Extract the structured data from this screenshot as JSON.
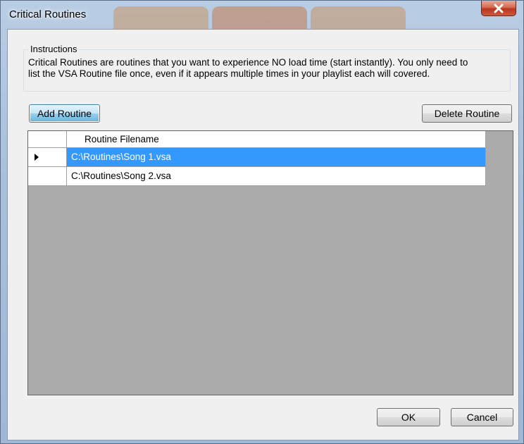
{
  "window": {
    "title": "Critical Routines"
  },
  "instructions": {
    "group_title": "Instructions",
    "line1": "Critical Routines are routines that you want to experience NO load time (start instantly). You only need to",
    "line2": "list the VSA Routine file once, even if it appears multiple times in your playlist each will covered."
  },
  "toolbar": {
    "add_label": "Add Routine",
    "delete_label": "Delete Routine"
  },
  "grid": {
    "columns": [
      "Routine Filename"
    ],
    "rows": [
      {
        "filename": "C:\\Routines\\Song 1.vsa",
        "selected": true
      },
      {
        "filename": "C:\\Routines\\Song 2.vsa",
        "selected": false
      }
    ]
  },
  "footer": {
    "ok_label": "OK",
    "cancel_label": "Cancel"
  },
  "icons": {
    "close": "close-icon",
    "current_row": "triangle-right-icon"
  },
  "colors": {
    "selection": "#3399ff",
    "grid_background": "#ababab",
    "close_button": "#c4432b"
  }
}
